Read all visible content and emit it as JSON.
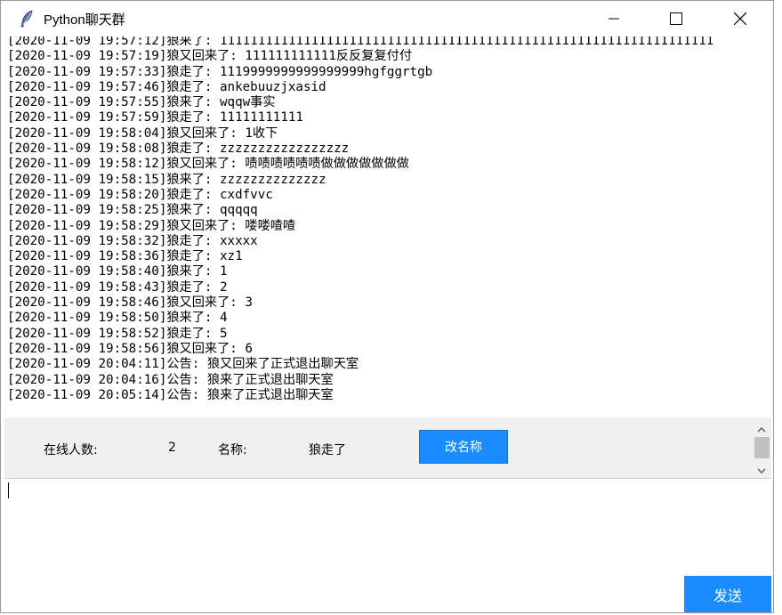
{
  "window": {
    "title": "Python聊天群",
    "icons": {
      "app": "feather-icon",
      "minimize": "minimize-icon",
      "maximize": "maximize-icon",
      "close": "close-icon"
    }
  },
  "chat_log": [
    "[2020-11-09 19:57:12]狼来了: 11111111111111111111111111111111111111111111111111111111111111111",
    "[2020-11-09 19:57:19]狼又回来了: 111111111111反反复复付付",
    "[2020-11-09 19:57:33]狼走了: 1119999999999999999hgfggrtgb",
    "[2020-11-09 19:57:46]狼走了: ankebuuzjxasid",
    "[2020-11-09 19:57:55]狼来了: wqqw事实",
    "[2020-11-09 19:57:59]狼走了: 11111111111",
    "[2020-11-09 19:58:04]狼又回来了: 1收下",
    "[2020-11-09 19:58:08]狼走了: zzzzzzzzzzzzzzzzz",
    "[2020-11-09 19:58:12]狼又回来了: 啧啧啧啧啧啧做做做做做做做",
    "[2020-11-09 19:58:15]狼来了: zzzzzzzzzzzzzz",
    "[2020-11-09 19:58:20]狼走了: cxdfvvc",
    "[2020-11-09 19:58:25]狼来了: qqqqq",
    "[2020-11-09 19:58:29]狼又回来了: 喽喽喳喳",
    "[2020-11-09 19:58:32]狼走了: xxxxx",
    "[2020-11-09 19:58:36]狼走了: xz1",
    "[2020-11-09 19:58:40]狼来了: 1",
    "[2020-11-09 19:58:43]狼走了: 2",
    "[2020-11-09 19:58:46]狼又回来了: 3",
    "[2020-11-09 19:58:50]狼来了: 4",
    "[2020-11-09 19:58:52]狼走了: 5",
    "[2020-11-09 19:58:56]狼又回来了: 6",
    "[2020-11-09 20:04:11]公告: 狼又回来了正式退出聊天室",
    "[2020-11-09 20:04:16]公告: 狼来了正式退出聊天室",
    "[2020-11-09 20:05:14]公告: 狼来了正式退出聊天室"
  ],
  "info_bar": {
    "online_label": "在线人数:",
    "online_count": "2",
    "name_label": "名称:",
    "name_value": "狼走了",
    "rename_button": "改名称"
  },
  "input": {
    "value": ""
  },
  "send_button": "发送",
  "colors": {
    "accent": "#1a8cff",
    "panel": "#f0f0f0"
  }
}
